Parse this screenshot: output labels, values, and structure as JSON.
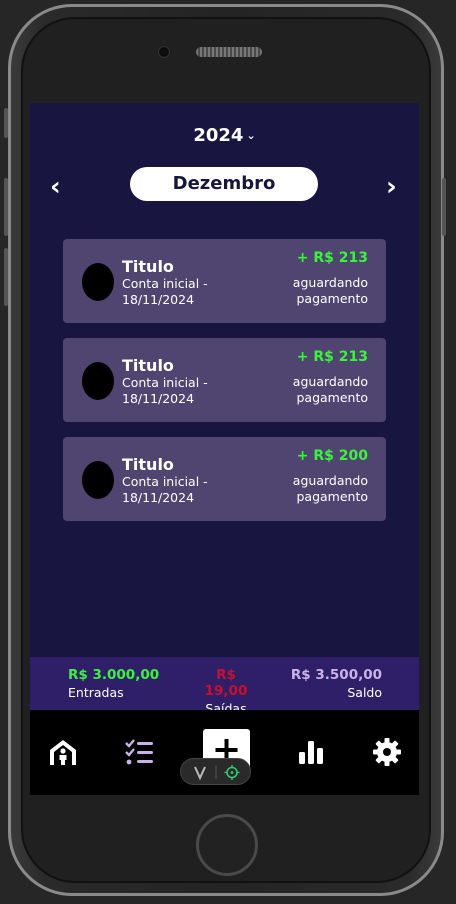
{
  "header": {
    "year": "2024",
    "month": "Dezembro"
  },
  "transactions": [
    {
      "title": "Titulo",
      "account": "Conta inicial -",
      "date": "18/11/2024",
      "amount": "+ R$ 213",
      "status_line1": "aguardando",
      "status_line2": "pagamento"
    },
    {
      "title": "Titulo",
      "account": "Conta inicial -",
      "date": "18/11/2024",
      "amount": "+ R$ 213",
      "status_line1": "aguardando",
      "status_line2": "pagamento"
    },
    {
      "title": "Titulo",
      "account": "Conta inicial -",
      "date": "18/11/2024",
      "amount": "+ R$ 200",
      "status_line1": "aguardando",
      "status_line2": "pagamento"
    }
  ],
  "summary": {
    "entradas": {
      "value": "R$ 3.000,00",
      "label": "Entradas",
      "color": "#39f53a"
    },
    "saidas": {
      "value": "R$ 19,00",
      "label": "Saídas",
      "color": "#c8102e"
    },
    "saldo": {
      "value": "R$ 3.500,00",
      "label": "Saldo",
      "color": "#c9b3e6"
    }
  },
  "tabs": [
    "home-icon",
    "checklist-icon",
    "add-icon",
    "bar-chart-icon",
    "gear-icon"
  ],
  "colors": {
    "background": "#181640",
    "card": "#4f4570",
    "summary_bar": "#2f1f69",
    "tab_bar": "#000000",
    "accent_green": "#39f53a"
  }
}
